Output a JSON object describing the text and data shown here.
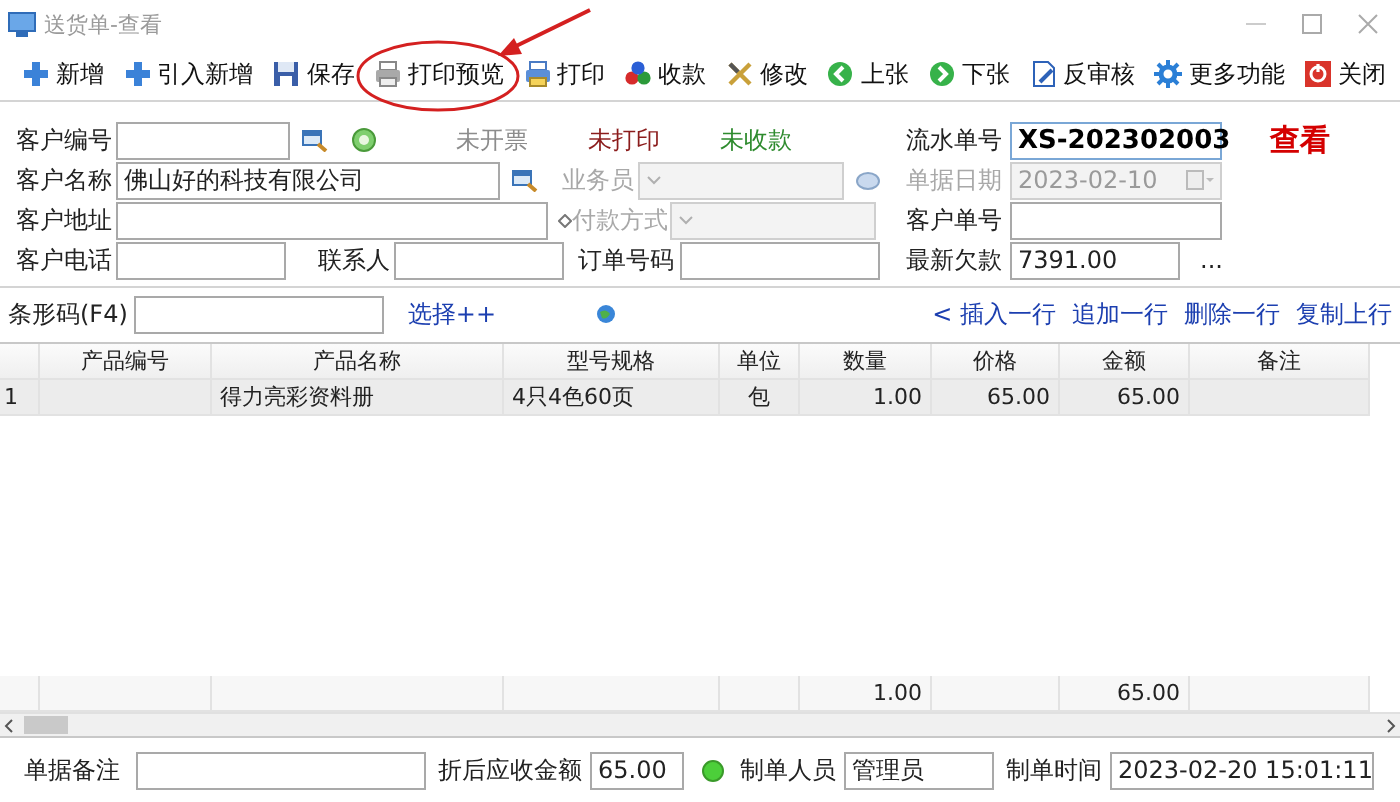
{
  "window": {
    "title": "送货单-查看"
  },
  "toolbar": [
    "新增",
    "引入新增",
    "保存",
    "打印预览",
    "打印",
    "收款",
    "修改",
    "上张",
    "下张",
    "反审核",
    "更多功能",
    "关闭"
  ],
  "form": {
    "customer_no": {
      "label": "客户编号",
      "disabled": false
    },
    "statuses": [
      {
        "text": "未开票",
        "color": "#8c8c8c"
      },
      {
        "text": "未打印",
        "color": "#8b1c1c"
      },
      {
        "text": "未收款",
        "color": "#2e8b2e"
      }
    ],
    "serial_no": {
      "label": "流水单号",
      "value": "XS-202302003",
      "disabled": false
    },
    "mode": "查看",
    "customer_name": {
      "label": "客户名称",
      "value": "佛山好的科技有限公司",
      "disabled": false
    },
    "salesperson": {
      "label": "业务员",
      "disabled": true
    },
    "bill_date": {
      "label": "单据日期",
      "value": "2023-02-10",
      "disabled": true
    },
    "customer_address": {
      "label": "客户地址",
      "disabled": false
    },
    "payment_method": {
      "label": "付款方式",
      "disabled": true
    },
    "customer_order_no": {
      "label": "客户单号",
      "disabled": false
    },
    "customer_phone": {
      "label": "客户电话",
      "disabled": false
    },
    "contact": {
      "label": "联系人",
      "disabled": false
    },
    "order_no": {
      "label": "订单号码",
      "disabled": false
    },
    "latest_debt": {
      "label": "最新欠款",
      "value": "7391.00",
      "disabled": false
    },
    "more": "..."
  },
  "barcode": {
    "label": "条形码(F4)",
    "select_link": "选择++"
  },
  "row_actions": [
    "< 插入一行",
    "追加一行",
    "删除一行",
    "复制上行"
  ],
  "table": {
    "columns": [
      "产品编号",
      "产品名称",
      "型号规格",
      "单位",
      "数量",
      "价格",
      "金额",
      "备注"
    ],
    "rows": [
      {
        "row_number": "1",
        "product_name": "得力亮彩资料册",
        "model": "4只4色60页",
        "unit": "包",
        "quantity": "1.00",
        "price": "65.00",
        "amount": "65.00"
      }
    ],
    "totals": {
      "quantity": "1.00",
      "amount": "65.00"
    }
  },
  "footer": {
    "bill_note": {
      "label": "单据备注",
      "disabled": false
    },
    "net_receivable": {
      "label": "折后应收金额",
      "value": "65.00",
      "disabled": false
    },
    "creator": {
      "label": "制单人员",
      "value": "管理员",
      "disabled": false
    },
    "created_time": {
      "label": "制单时间",
      "value": "2023-02-20 15:01:11",
      "disabled": false
    }
  }
}
